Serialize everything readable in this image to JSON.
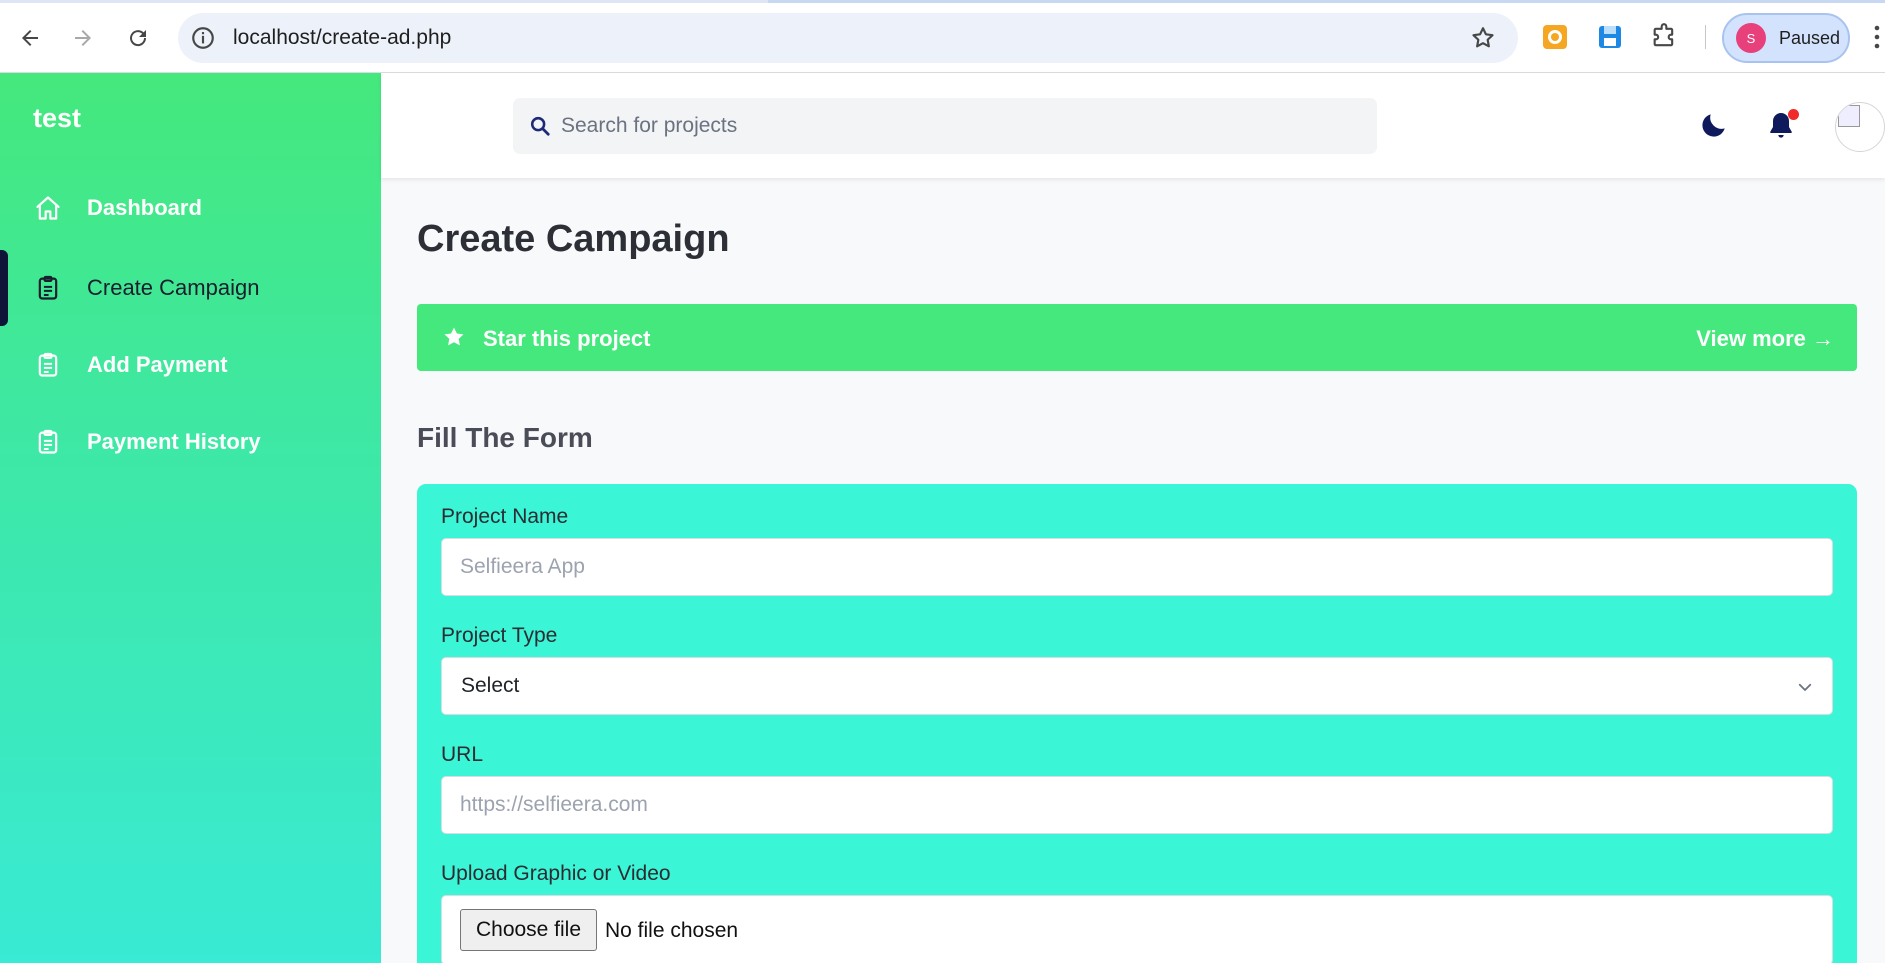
{
  "browser": {
    "url": "localhost/create-ad.php",
    "profile_initial": "S",
    "profile_status": "Paused"
  },
  "sidebar": {
    "brand": "test",
    "items": [
      {
        "label": "Dashboard",
        "icon": "home-icon"
      },
      {
        "label": "Create Campaign",
        "icon": "clipboard-icon"
      },
      {
        "label": "Add Payment",
        "icon": "clipboard-icon"
      },
      {
        "label": "Payment History",
        "icon": "clipboard-icon"
      }
    ],
    "active_index": 1
  },
  "header": {
    "search_placeholder": "Search for projects"
  },
  "main": {
    "title": "Create Campaign",
    "banner": {
      "text": "Star this project",
      "link": "View more →"
    },
    "form_title": "Fill The Form",
    "form": {
      "project_name_label": "Project Name",
      "project_name_placeholder": "Selfieera App",
      "project_type_label": "Project Type",
      "project_type_value": "Select",
      "url_label": "URL",
      "url_placeholder": "https://selfieera.com",
      "upload_label": "Upload Graphic or Video",
      "choose_file_label": "Choose file",
      "no_file_text": "No file chosen"
    }
  },
  "colors": {
    "sidebar_top": "#45e87c",
    "sidebar_bottom": "#39ead4",
    "banner": "#45e87c",
    "form_card": "#3af5d6",
    "notification_dot": "#ef2b2b"
  }
}
